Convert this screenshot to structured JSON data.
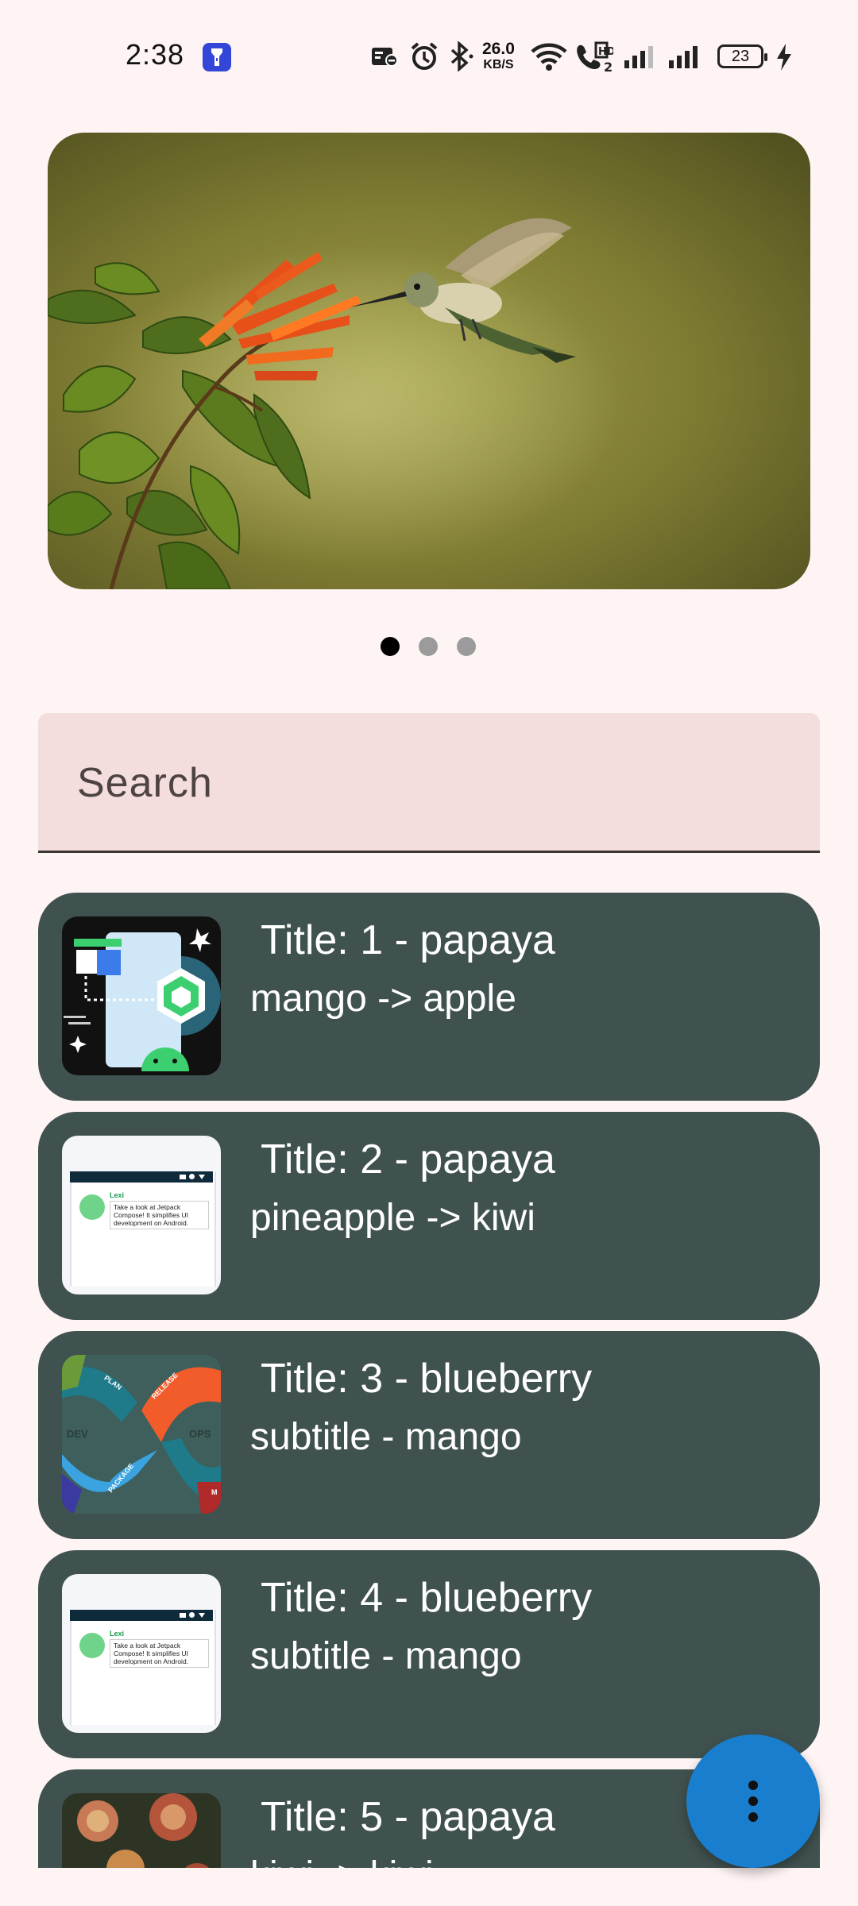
{
  "status_bar": {
    "time": "2:38",
    "network_speed_value": "26.0",
    "network_speed_unit": "KB/S",
    "battery_level": "23",
    "icons": [
      "flashlight-icon",
      "notification-muted-icon",
      "alarm-icon",
      "bluetooth-icon",
      "wifi-icon",
      "volte-call-icon",
      "signal-sim1-icon",
      "signal-sim2-icon",
      "battery-icon",
      "charging-icon"
    ]
  },
  "carousel": {
    "image_description": "hummingbird-feeding-on-orange-flower",
    "page_count": 3,
    "active_page": 1
  },
  "search": {
    "placeholder": "Search"
  },
  "list": {
    "items": [
      {
        "title": "Title: 1 - papaya",
        "subtitle": "mango -> apple",
        "thumb": "android-jetpack-illustration"
      },
      {
        "title": "Title: 2 - papaya",
        "subtitle": "pineapple -> kiwi",
        "thumb": "compose-chat-screenshot"
      },
      {
        "title": "Title: 3 - blueberry",
        "subtitle": "subtitle - mango",
        "thumb": "devops-loop-diagram"
      },
      {
        "title": "Title: 4 - blueberry",
        "subtitle": "subtitle - mango",
        "thumb": "compose-chat-screenshot"
      },
      {
        "title": "Title: 5 - papaya",
        "subtitle": "kiwi -> kiwi",
        "thumb": "protea-flowers-photo"
      }
    ],
    "thumb_text": {
      "chat_name": "Lexi",
      "chat_message": "Take a look at Jetpack Compose! It simplifies UI development on Android.",
      "devops_labels": [
        "PLAN",
        "RELEASE",
        "DEV",
        "OPS",
        "PACKAGE",
        "M"
      ]
    }
  },
  "fab": {
    "icon": "more-vert-icon"
  },
  "colors": {
    "background": "#FFF4F4",
    "card": "#40524F",
    "search_field": "#F3DDDD",
    "fab": "#1A7ECF"
  }
}
